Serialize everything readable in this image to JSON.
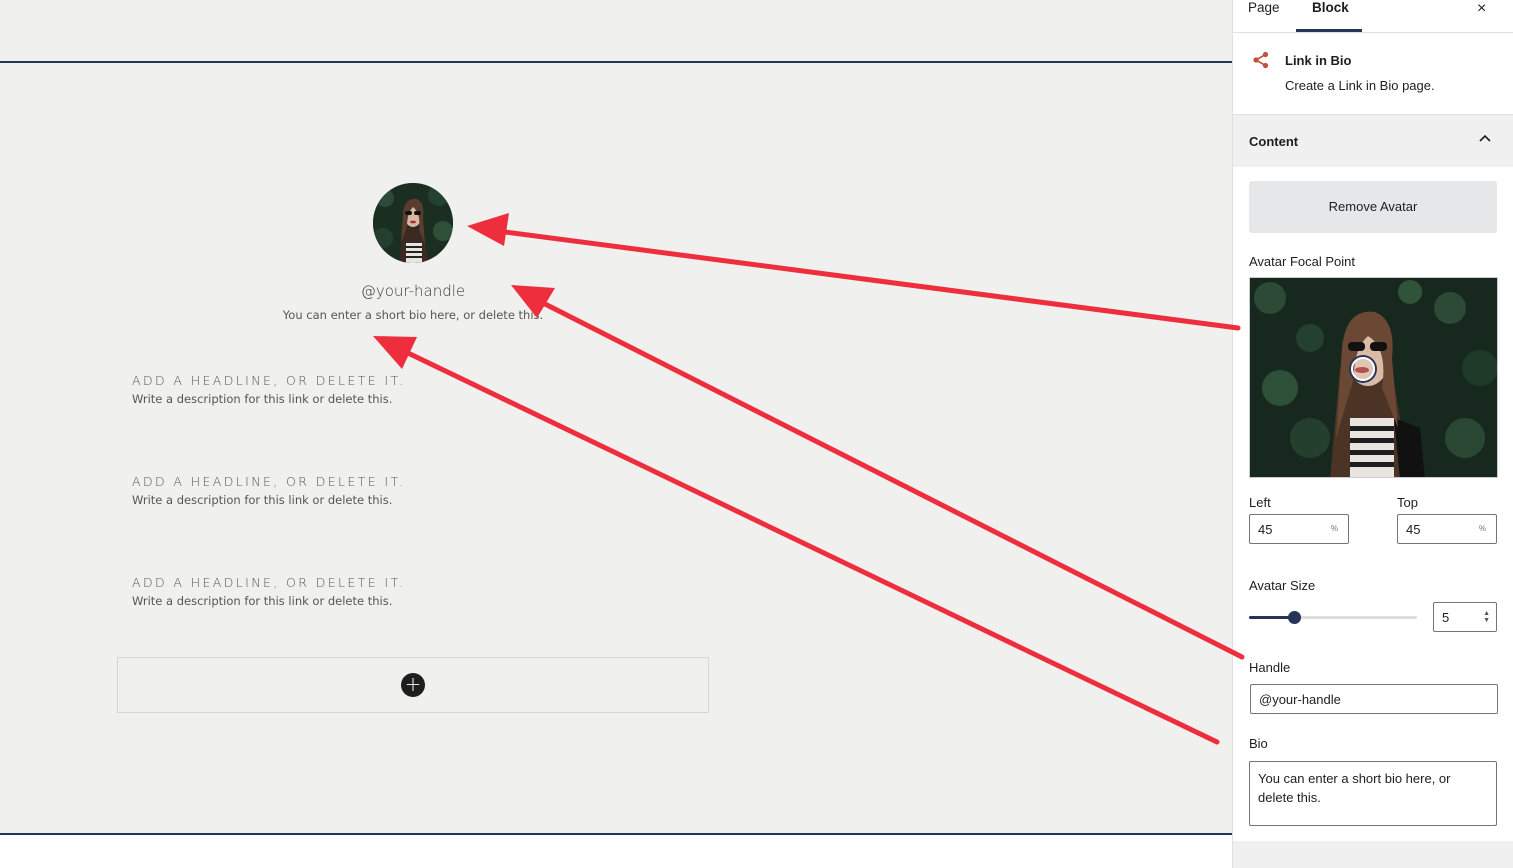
{
  "canvas": {
    "handle": "@your-handle",
    "bio": "You can enter a short bio here, or delete this.",
    "links": [
      {
        "headline": "ADD A HEADLINE, OR DELETE IT.",
        "description": "Write a description for this link or delete this."
      },
      {
        "headline": "ADD A HEADLINE, OR DELETE IT.",
        "description": "Write a description for this link or delete this."
      },
      {
        "headline": "ADD A HEADLINE, OR DELETE IT.",
        "description": "Write a description for this link or delete this."
      }
    ],
    "add_icon": "+",
    "annotation_arrow_color": "#ee2e3c"
  },
  "sidebar": {
    "tabs": [
      {
        "label": "Page"
      },
      {
        "label": "Block"
      }
    ],
    "active_tab": "Block",
    "close_icon": "×",
    "block": {
      "icon": "share-icon",
      "title": "Link in Bio",
      "description": "Create a Link in Bio page."
    },
    "content_panel": {
      "title": "Content",
      "expanded": true
    },
    "remove_avatar_label": "Remove Avatar",
    "focal_point": {
      "label": "Avatar Focal Point",
      "left_label": "Left",
      "left_value": "45",
      "top_label": "Top",
      "top_value": "45",
      "unit": "%"
    },
    "avatar_size": {
      "label": "Avatar Size",
      "value": "5",
      "fraction": 0.27
    },
    "handle_field": {
      "label": "Handle",
      "value": "@your-handle"
    },
    "bio_field": {
      "label": "Bio",
      "value": "You can enter a short bio here, or delete this."
    },
    "accent_color": "#27345a",
    "brand_icon_color": "#c0523a"
  }
}
